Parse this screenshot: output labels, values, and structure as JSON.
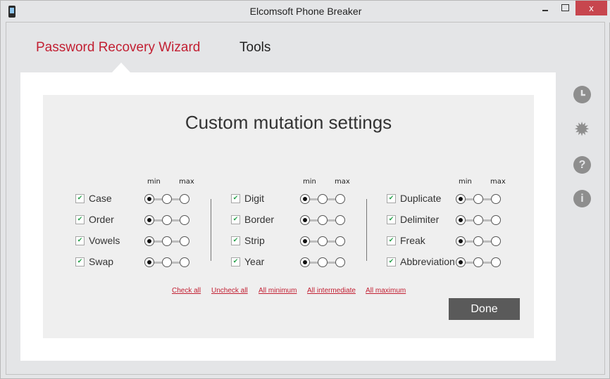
{
  "window": {
    "title": "Elcomsoft Phone Breaker",
    "close_glyph": "x"
  },
  "nav": {
    "items": [
      {
        "label": "Password Recovery Wizard",
        "active": true
      },
      {
        "label": "Tools",
        "active": false
      }
    ]
  },
  "side_icons": [
    "history-icon",
    "settings-icon",
    "help-icon",
    "info-icon"
  ],
  "side_glyphs": {
    "help": "?",
    "info": "i",
    "gear": "✹"
  },
  "dialog": {
    "title": "Custom mutation settings",
    "min_label": "min",
    "max_label": "max",
    "check_glyph": "✔",
    "groups": [
      {
        "items": [
          {
            "label": "Case",
            "checked": true,
            "level": "min"
          },
          {
            "label": "Order",
            "checked": true,
            "level": "min"
          },
          {
            "label": "Vowels",
            "checked": true,
            "level": "min"
          },
          {
            "label": "Swap",
            "checked": true,
            "level": "min"
          }
        ]
      },
      {
        "items": [
          {
            "label": "Digit",
            "checked": true,
            "level": "min"
          },
          {
            "label": "Border",
            "checked": true,
            "level": "min"
          },
          {
            "label": "Strip",
            "checked": true,
            "level": "min"
          },
          {
            "label": "Year",
            "checked": true,
            "level": "min"
          }
        ]
      },
      {
        "items": [
          {
            "label": "Duplicate",
            "checked": true,
            "level": "min"
          },
          {
            "label": "Delimiter",
            "checked": true,
            "level": "min"
          },
          {
            "label": "Freak",
            "checked": true,
            "level": "min"
          },
          {
            "label": "Abbreviation",
            "checked": true,
            "level": "min"
          }
        ]
      }
    ],
    "links": [
      "Check all",
      "Uncheck all",
      "All minimum",
      "All intermediate",
      "All maximum"
    ],
    "done_label": "Done"
  },
  "colors": {
    "accent": "#c21f32",
    "check": "#26a04a",
    "close": "#c7464e",
    "done_bg": "#5a5a5a"
  }
}
